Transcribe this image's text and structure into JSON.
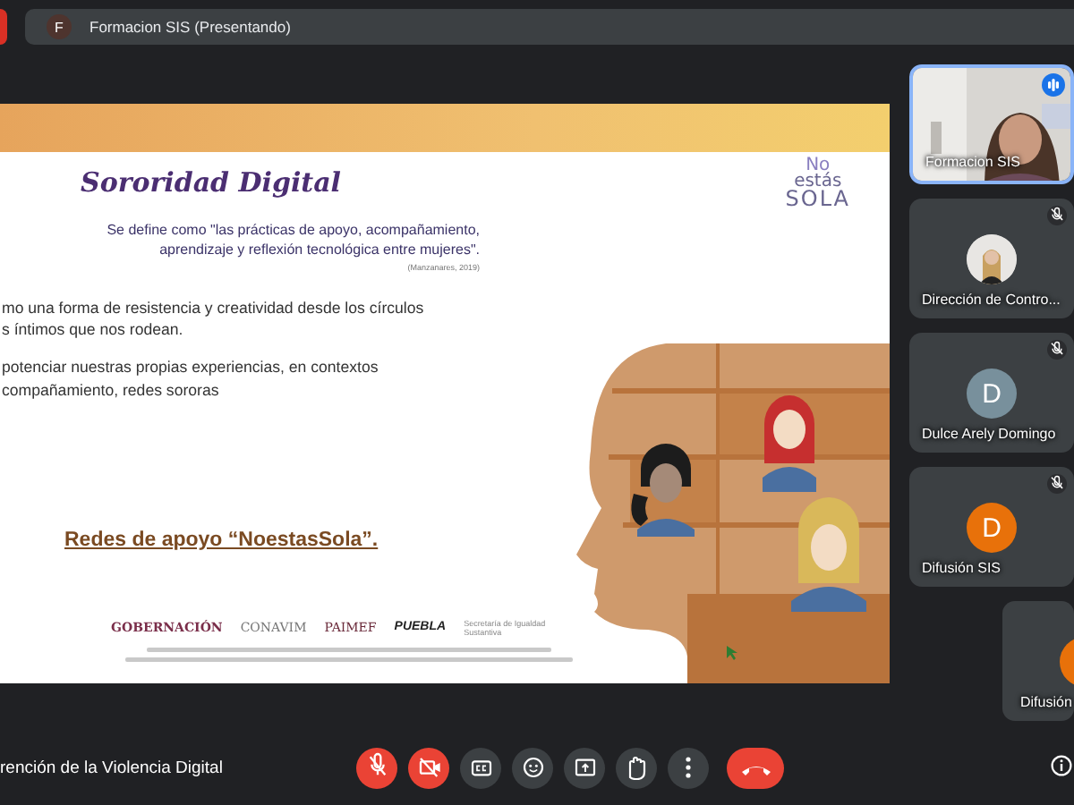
{
  "top_bar": {
    "presenter_initial": "F",
    "presenter_label": "Formacion SIS (Presentando)"
  },
  "slide": {
    "title": "Sororidad Digital",
    "logo_lines": [
      "No",
      "estás",
      "SOLA"
    ],
    "definition": "Se define como \"las prácticas de apoyo, acompañamiento, aprendizaje y reflexión tecnológica entre mujeres\".",
    "citation": "(Manzanares, 2019)",
    "paragraphs": [
      [
        "mo una forma de resistencia y creatividad desde los círculos",
        "s íntimos que nos rodean."
      ],
      [
        "potenciar nuestras propias experiencias, en contextos",
        "compañamiento, redes sororas"
      ]
    ],
    "link": "Redes de apoyo “NoestasSola”.",
    "sponsors": [
      "GOBERNACIÓN",
      "CONAVIM",
      "PAIMEF",
      "PUEBLA",
      "Secretaría de Igualdad Sustantiva"
    ]
  },
  "participants": [
    {
      "name": "Formacion SIS",
      "kind": "video",
      "speaking": true,
      "muted": false
    },
    {
      "name": "Dirección de Contro...",
      "speaking": false,
      "muted": true
    },
    {
      "name": "Dulce Arely Domingo",
      "kind": "initial",
      "initial": "D",
      "color": "#78909c",
      "speaking": false,
      "muted": true
    },
    {
      "name": "Difusión SIS",
      "kind": "initial",
      "initial": "D",
      "color": "#e8710a",
      "speaking": false,
      "muted": true
    },
    {
      "name": "Difusión",
      "kind": "initial",
      "color": "#e8710a",
      "speaking": false,
      "muted": false
    }
  ],
  "bottom_bar": {
    "meeting_title": "rención de la Violencia Digital",
    "controls": [
      {
        "kind": "mic",
        "on": false
      },
      {
        "kind": "camera",
        "on": false
      },
      {
        "kind": "captions"
      },
      {
        "kind": "emoji"
      },
      {
        "kind": "present"
      },
      {
        "kind": "hand"
      },
      {
        "kind": "more"
      },
      {
        "kind": "leave"
      }
    ]
  }
}
